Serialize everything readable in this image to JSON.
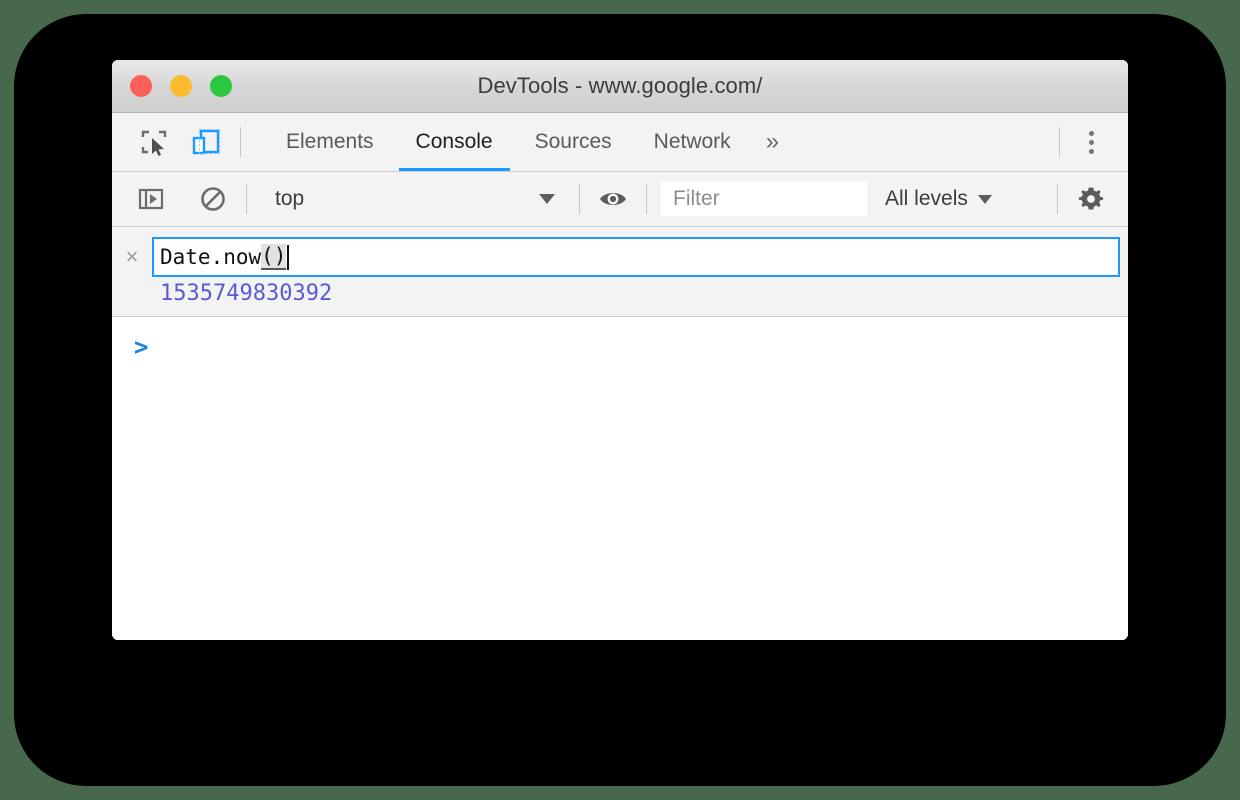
{
  "window": {
    "title": "DevTools - www.google.com/",
    "traffic_lights": [
      {
        "name": "close",
        "color": "#fc6058"
      },
      {
        "name": "minimize",
        "color": "#fdbc2f"
      },
      {
        "name": "maximize",
        "color": "#2bc840"
      }
    ]
  },
  "tabbar": {
    "inspect_icon": "inspect-element-icon",
    "device_icon": "device-toolbar-icon",
    "tabs": [
      {
        "label": "Elements",
        "active": false
      },
      {
        "label": "Console",
        "active": true
      },
      {
        "label": "Sources",
        "active": false
      },
      {
        "label": "Network",
        "active": false
      }
    ],
    "overflow_label": "»",
    "more_menu_icon": "kebab-menu-icon"
  },
  "console_toolbar": {
    "sidebar_icon": "show-console-sidebar-icon",
    "clear_icon": "clear-console-icon",
    "context": {
      "value": "top",
      "caret_icon": "chevron-down-icon"
    },
    "eye_icon": "live-expression-eye-icon",
    "filter": {
      "value": "",
      "placeholder": "Filter"
    },
    "levels": {
      "label": "All levels",
      "caret_icon": "chevron-down-icon"
    },
    "settings_icon": "settings-gear-icon"
  },
  "console": {
    "clear_entry_icon": "×",
    "command": {
      "typed": "Date.now",
      "autocomplete": "()"
    },
    "result": "1535749830392",
    "prompt": ">"
  },
  "colors": {
    "accent_blue": "#1a9afe",
    "result_purple": "#5a5ad6",
    "prompt_blue": "#1a82e2",
    "toolbar_bg": "#f3f3f3",
    "titlebar_bg": "#d6d6d6",
    "backdrop": "#000000",
    "page_bg": "#47684c"
  }
}
